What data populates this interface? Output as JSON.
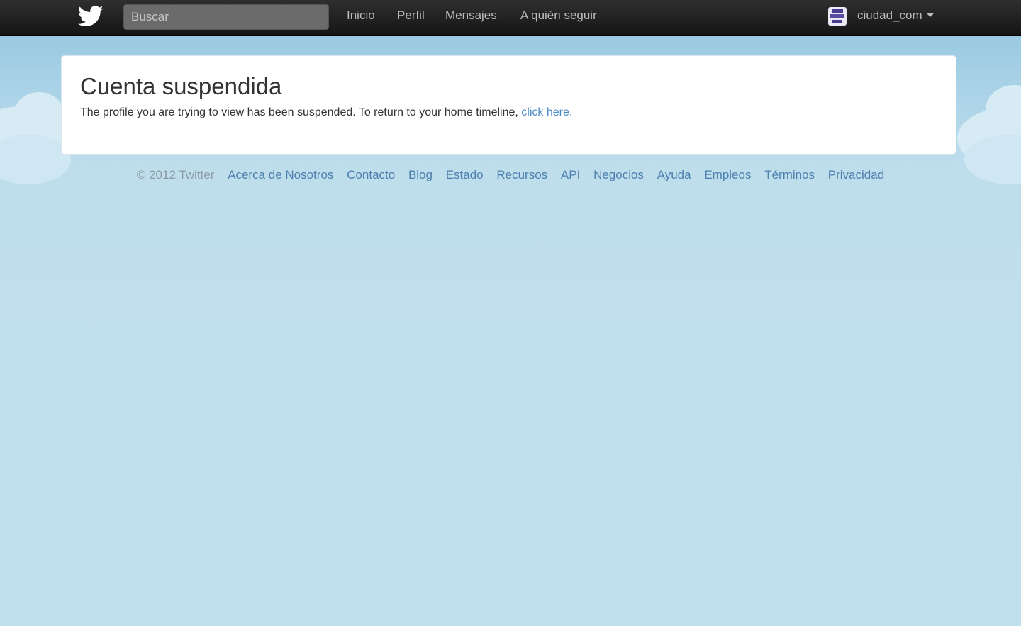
{
  "colors": {
    "topbar": "#1c1c1c",
    "link": "#4b8ac6",
    "footer_link": "#4d7fae",
    "background": "#c0dfed"
  },
  "header": {
    "logo_icon": "twitter-bird-icon",
    "search": {
      "placeholder": "Buscar",
      "value": ""
    },
    "nav": [
      "Inicio",
      "Perfil",
      "Mensajes",
      "A quién seguir"
    ],
    "user": {
      "name": "ciudad_com",
      "avatar_icon": "user-avatar"
    }
  },
  "main": {
    "title": "Cuenta suspendida",
    "message": "The profile you are trying to view has been suspended. To return to your home timeline,",
    "link_text": "click here."
  },
  "footer": {
    "copyright": "© 2012 Twitter",
    "links": [
      "Acerca de Nosotros",
      "Contacto",
      "Blog",
      "Estado",
      "Recursos",
      "API",
      "Negocios",
      "Ayuda",
      "Empleos",
      "Términos",
      "Privacidad"
    ]
  }
}
